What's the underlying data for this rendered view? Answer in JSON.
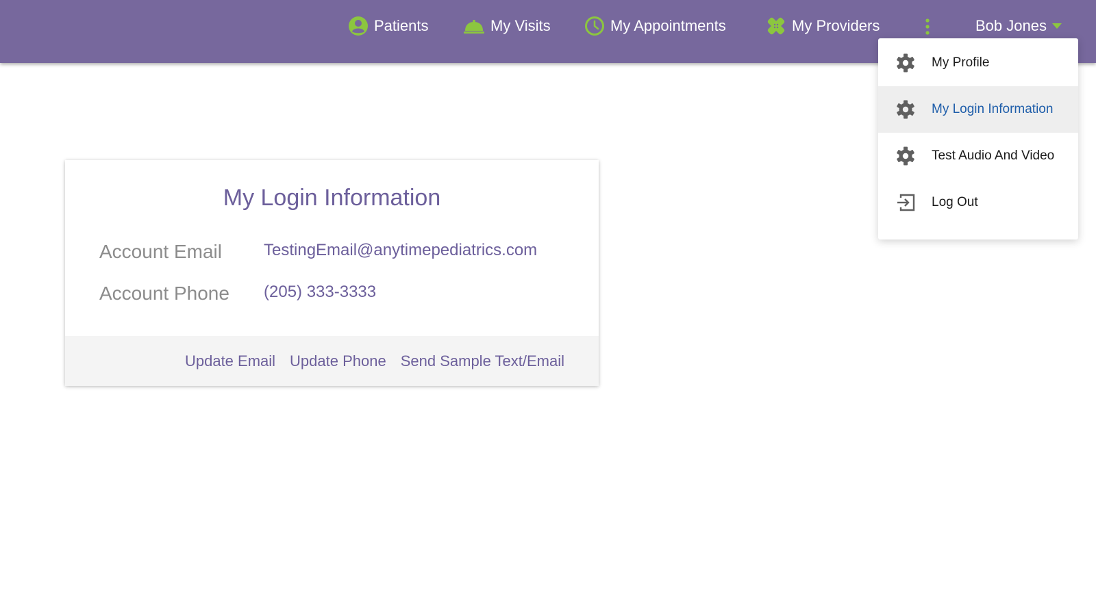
{
  "colors": {
    "topbar_bg": "#77689d",
    "accent_green": "#8cc63f",
    "brand_purple": "#6c5f9b",
    "active_menu_text": "#1f5eaa",
    "active_menu_bg": "#eeeeee",
    "footer_bg": "#f4f4f4"
  },
  "nav": {
    "items": [
      {
        "label": "Patients",
        "icon": "person-circle-icon"
      },
      {
        "label": "My Visits",
        "icon": "service-bell-icon"
      },
      {
        "label": "My Appointments",
        "icon": "clock-icon"
      },
      {
        "label": "My Providers",
        "icon": "bandage-icon"
      }
    ],
    "more_icon": "more-vertical-icon",
    "user_name": "Bob Jones",
    "user_caret_icon": "caret-down-icon"
  },
  "dropdown": {
    "items": [
      {
        "label": "My Profile",
        "icon": "gear-icon",
        "active": false
      },
      {
        "label": "My Login Information",
        "icon": "gear-icon",
        "active": true
      },
      {
        "label": "Test Audio And Video",
        "icon": "gear-icon",
        "active": false
      },
      {
        "label": "Log Out",
        "icon": "logout-icon",
        "active": false
      }
    ]
  },
  "card": {
    "title": "My Login Information",
    "email_label": "Account Email",
    "email_value": "TestingEmail@anytimepediatrics.com",
    "phone_label": "Account Phone",
    "phone_value": "(205) 333-3333",
    "actions": {
      "update_email": "Update Email",
      "update_phone": "Update Phone",
      "send_sample": "Send Sample Text/Email"
    }
  }
}
